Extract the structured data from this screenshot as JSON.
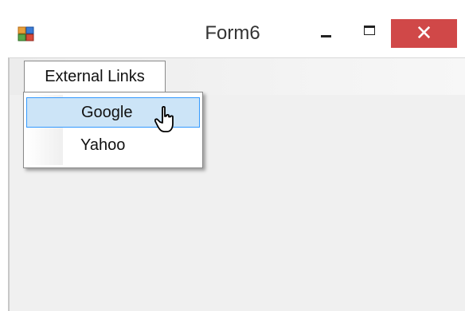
{
  "window": {
    "title": "Form6",
    "controls": {
      "minimize_icon": "minimize-icon",
      "maximize_icon": "maximize-icon",
      "close_glyph": "✕"
    }
  },
  "menubar": {
    "items": [
      {
        "label": "External Links"
      }
    ]
  },
  "dropdown": {
    "items": [
      {
        "label": "Google",
        "state": "hover"
      },
      {
        "label": "Yahoo"
      }
    ]
  },
  "colors": {
    "close_button": "#d04848",
    "client_background": "#f0f0f0",
    "hover_fill": "#cce4f7",
    "hover_border": "#3399ff"
  }
}
